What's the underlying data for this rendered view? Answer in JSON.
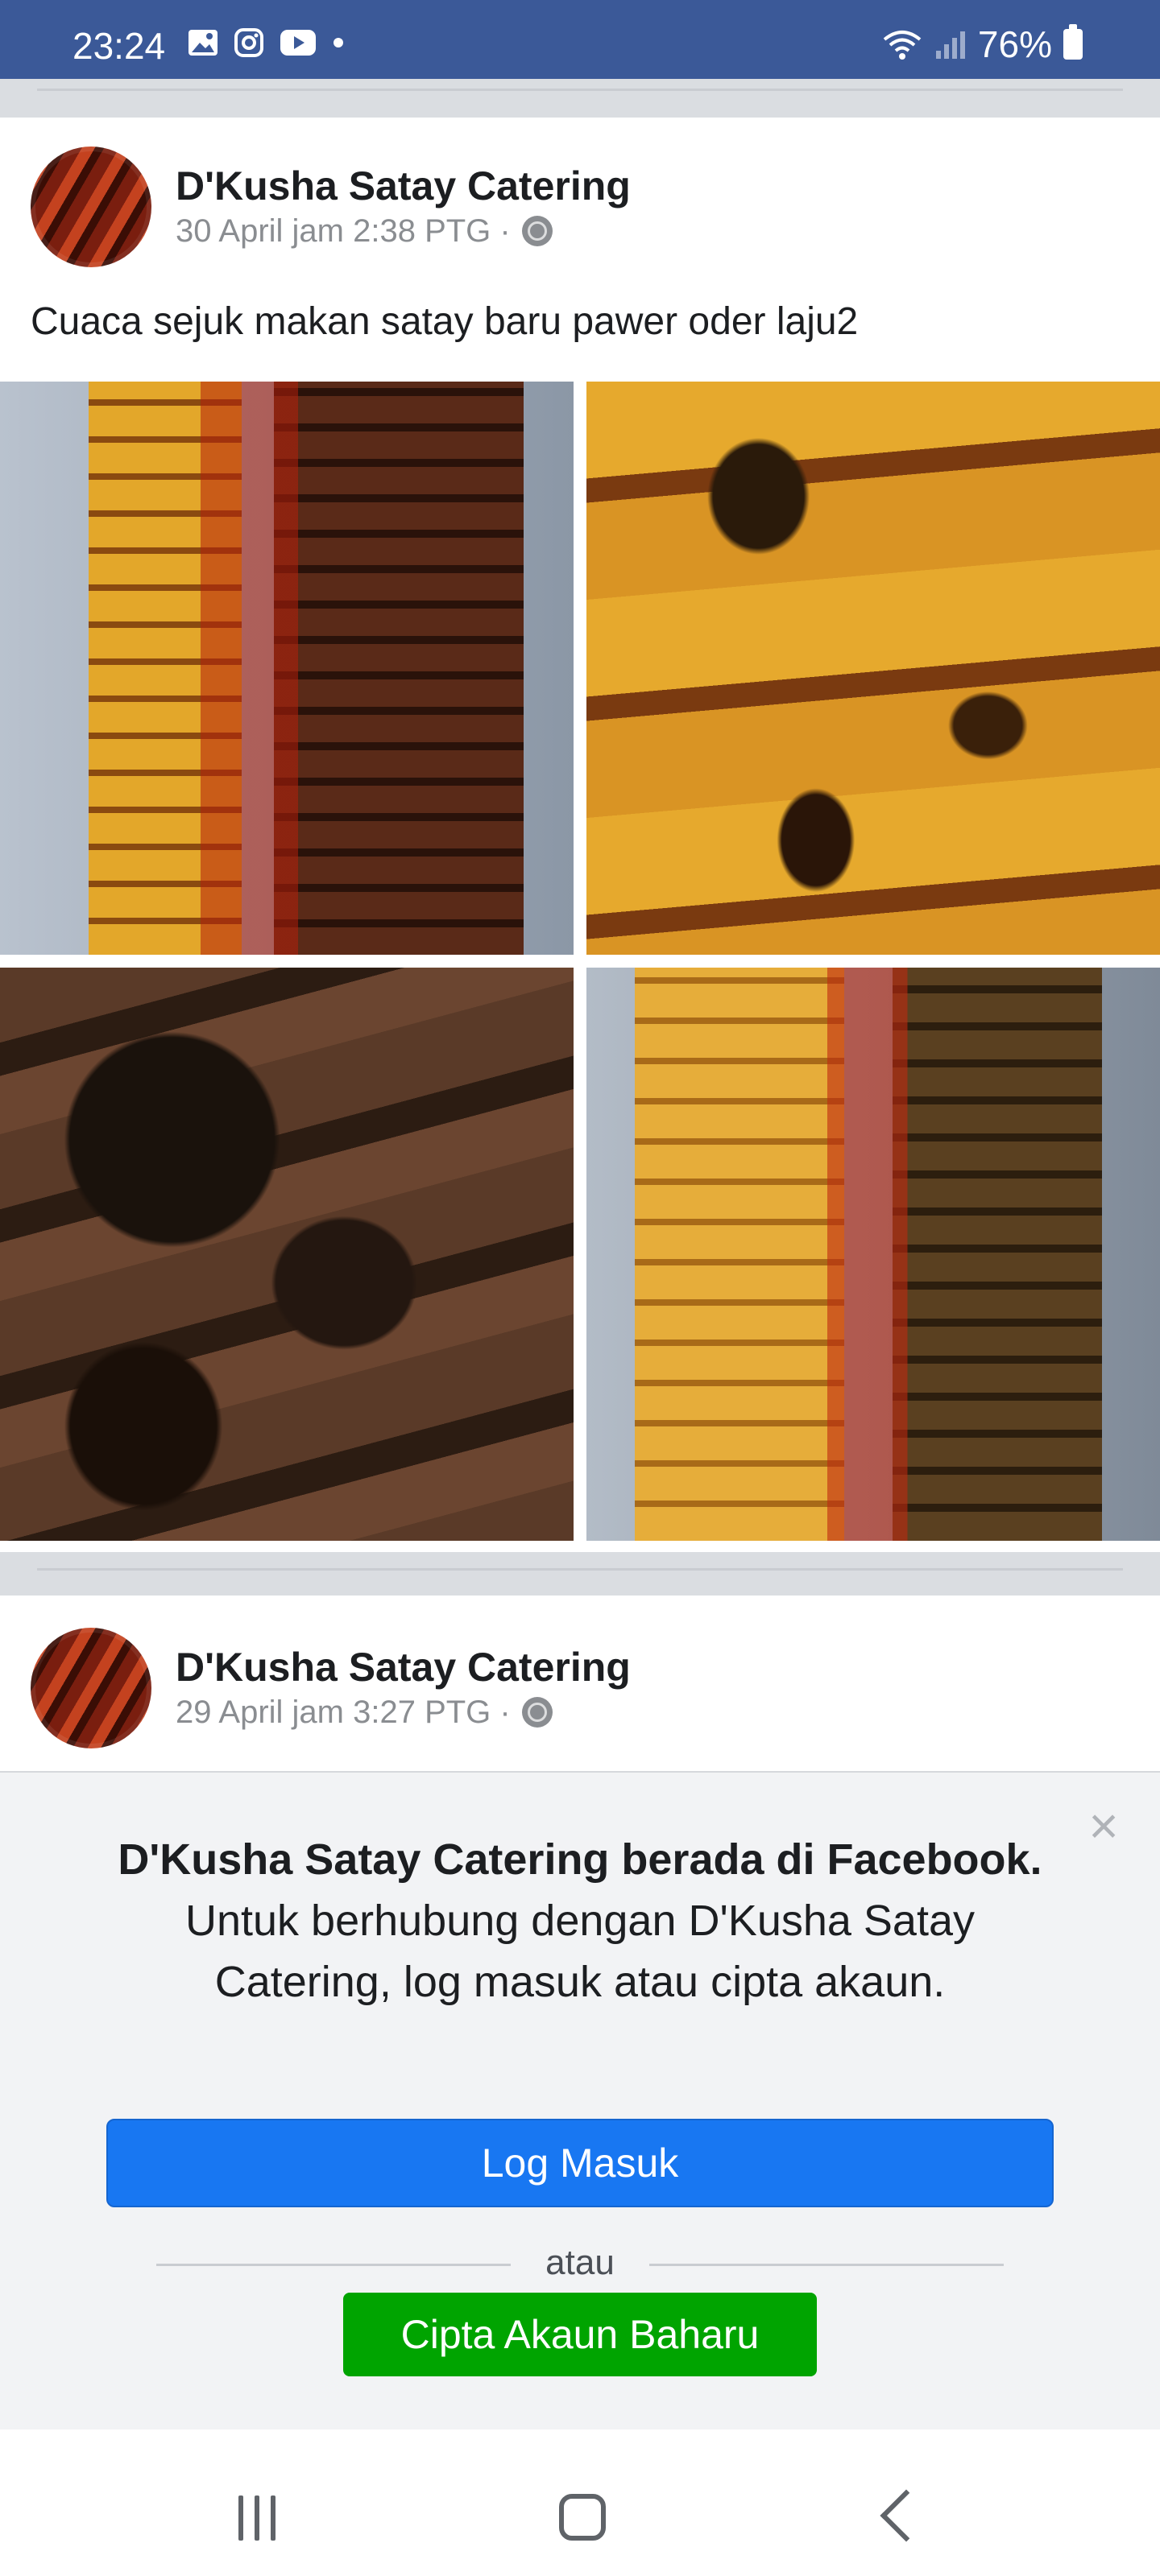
{
  "status_bar": {
    "time": "23:24",
    "battery": "76%",
    "icons": [
      "image-icon",
      "instagram-icon",
      "youtube-icon",
      "dot-icon",
      "wifi-icon",
      "signal-icon",
      "battery-icon"
    ]
  },
  "posts": [
    {
      "author": "D'Kusha Satay Catering",
      "timestamp": "30 April jam 2:38 PTG ·",
      "text": "Cuaca sejuk makan satay baru pawer oder laju2",
      "photos": [
        "satay-photo-1",
        "satay-photo-2",
        "satay-photo-3",
        "satay-photo-4"
      ]
    },
    {
      "author": "D'Kusha Satay Catering",
      "timestamp": "29 April jam 3:27 PTG ·"
    }
  ],
  "login_dialog": {
    "message_bold": "D'Kusha Satay Catering berada di Facebook.",
    "message_rest": " Untuk berhubung dengan D'Kusha Satay Catering, log masuk atau cipta akaun.",
    "login_label": "Log Masuk",
    "or_label": "atau",
    "create_label": "Cipta Akaun Baharu",
    "close_glyph": "×"
  },
  "colors": {
    "status_bar": "#3b5998",
    "login_button": "#1877f2",
    "create_button": "#00a400"
  }
}
